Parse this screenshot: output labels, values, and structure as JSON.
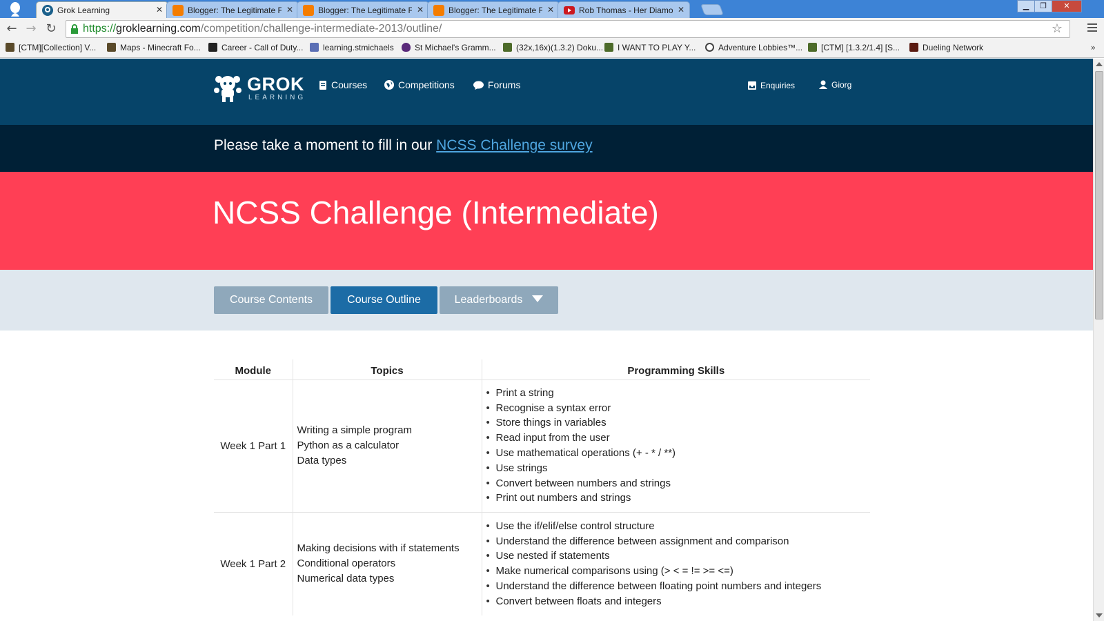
{
  "browser": {
    "tabs": [
      {
        "title": "Grok Learning",
        "favicon": "grok-icon",
        "color": "#1a5f8a",
        "active": true
      },
      {
        "title": "Blogger: The Legitimate F",
        "favicon": "blogger-icon",
        "color": "#f57d00",
        "active": false
      },
      {
        "title": "Blogger: The Legitimate F",
        "favicon": "blogger-icon",
        "color": "#f57d00",
        "active": false
      },
      {
        "title": "Blogger: The Legitimate F",
        "favicon": "blogger-icon",
        "color": "#f57d00",
        "active": false
      },
      {
        "title": "Rob Thomas - Her Diamo",
        "favicon": "youtube-icon",
        "color": "#cc181e",
        "active": false
      }
    ],
    "url_scheme": "https://",
    "url_host": "groklearning.com",
    "url_path": "/competition/challenge-intermediate-2013/outline/",
    "bookmarks": [
      {
        "label": "[CTM][Collection] V...",
        "icon": "minecraft-block-icon"
      },
      {
        "label": "Maps - Minecraft Fo...",
        "icon": "minecraft-block-icon"
      },
      {
        "label": "Career - Call of Duty...",
        "icon": "cod-icon"
      },
      {
        "label": "learning.stmichaels",
        "icon": "school-icon"
      },
      {
        "label": "St Michael's Gramm...",
        "icon": "crest-icon"
      },
      {
        "label": "(32x,16x)(1.3.2) Doku...",
        "icon": "minecraft-block-icon"
      },
      {
        "label": "I WANT TO PLAY Y...",
        "icon": "minecraft-block-icon"
      },
      {
        "label": "Adventure Lobbies™...",
        "icon": "circle-logo-icon"
      },
      {
        "label": "[CTM] [1.3.2/1.4] [S...",
        "icon": "minecraft-block-icon"
      },
      {
        "label": "Dueling Network",
        "icon": "card-icon"
      }
    ],
    "bookmarks_more": "»"
  },
  "header": {
    "brand": "GROK",
    "brand_sub": "LEARNING",
    "nav": [
      {
        "label": "Courses",
        "icon": "book-icon"
      },
      {
        "label": "Competitions",
        "icon": "globe-icon"
      },
      {
        "label": "Forums",
        "icon": "speech-bubble-icon"
      }
    ],
    "enquiries": "Enquiries",
    "user": "Giorg"
  },
  "survey": {
    "prefix": "Please take a moment to fill in our ",
    "link": "NCSS Challenge survey"
  },
  "hero": {
    "title": "NCSS Challenge (Intermediate)"
  },
  "course_tabs": {
    "contents": "Course Contents",
    "outline": "Course Outline",
    "leaderboards": "Leaderboards"
  },
  "outline": {
    "headers": [
      "Module",
      "Topics",
      "Programming Skills"
    ],
    "rows": [
      {
        "module": "Week 1 Part 1",
        "topics": [
          "Writing a simple program",
          "Python as a calculator",
          "Data types"
        ],
        "skills": [
          "Print a string",
          "Recognise a syntax error",
          "Store things in variables",
          "Read input from the user",
          "Use mathematical operations (+ - * / **)",
          "Use strings",
          "Convert between numbers and strings",
          "Print out numbers and strings"
        ]
      },
      {
        "module": "Week 1 Part 2",
        "topics": [
          "Making decisions with if statements",
          "Conditional operators",
          "Numerical data types"
        ],
        "skills": [
          "Use the if/elif/else control structure",
          "Understand the difference between assignment and comparison",
          "Use nested if statements",
          "Make numerical comparisons using (> < = != >= <=)",
          "Understand the difference between floating point numbers and integers",
          "Convert between floats and integers"
        ]
      }
    ]
  },
  "colors": {
    "header_bg": "#064469",
    "survey_bg": "#002036",
    "hero_bg": "#ff3f55",
    "tabsbar_bg": "#dfe7ee",
    "primary_button": "#1c6ca6",
    "muted_button": "#8fa8bb",
    "link": "#4fa6e0"
  }
}
